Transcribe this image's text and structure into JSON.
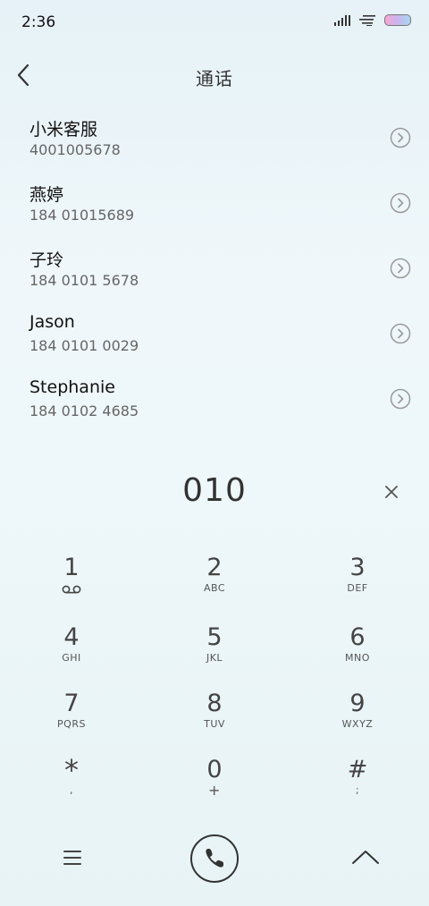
{
  "status_bar": {
    "time": "2:36",
    "icons": [
      "signal-icon",
      "wifi-icon",
      "battery-icon"
    ]
  },
  "header": {
    "title": "通话",
    "back_icon": "chevron-left-icon"
  },
  "contacts": [
    {
      "name": "小米客服",
      "number": "4001005678"
    },
    {
      "name": "燕婷",
      "number": "184 01015689"
    },
    {
      "name": "子玲",
      "number": "184 0101 5678"
    },
    {
      "name": "Jason",
      "number": "184 0101 0029"
    },
    {
      "name": "Stephanie",
      "number": "184 0102 4685"
    }
  ],
  "dialer": {
    "number": "010",
    "clear_icon": "close-icon"
  },
  "keypad": [
    {
      "digit": "1",
      "sub": "",
      "icon": "voicemail-icon"
    },
    {
      "digit": "2",
      "sub": "ABC"
    },
    {
      "digit": "3",
      "sub": "DEF"
    },
    {
      "digit": "4",
      "sub": "GHI"
    },
    {
      "digit": "5",
      "sub": "JKL"
    },
    {
      "digit": "6",
      "sub": "MNO"
    },
    {
      "digit": "7",
      "sub": "PQRS"
    },
    {
      "digit": "8",
      "sub": "TUV"
    },
    {
      "digit": "9",
      "sub": "WXYZ"
    },
    {
      "digit": "*",
      "sub": ","
    },
    {
      "digit": "0",
      "sub": "+"
    },
    {
      "digit": "#",
      "sub": ";"
    }
  ],
  "bottom_bar": {
    "menu_icon": "menu-icon",
    "call_icon": "phone-icon",
    "collapse_icon": "chevron-up-icon"
  },
  "colors": {
    "background_top": "#e6f2f7",
    "background_bottom": "#e7f3f5",
    "text_primary": "#111111",
    "text_secondary": "#666666",
    "icon": "#444444"
  }
}
